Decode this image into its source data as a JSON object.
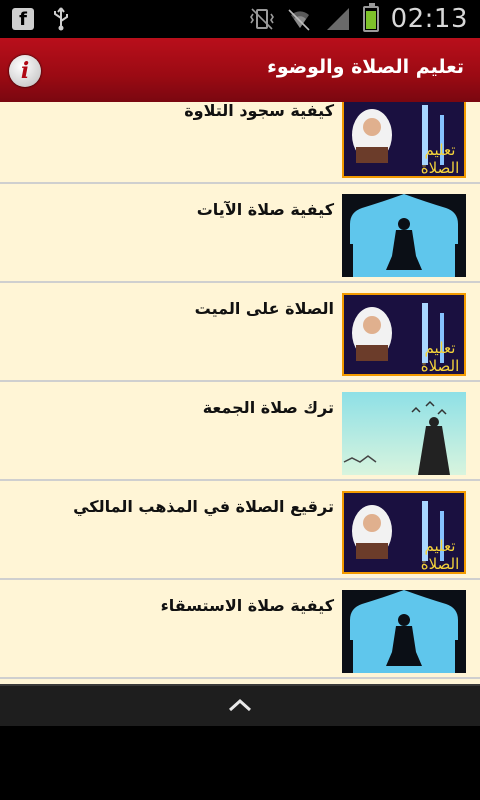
{
  "status_bar": {
    "time": "02:13"
  },
  "app_bar": {
    "title": "تعليم الصلاة والوضوء"
  },
  "list": {
    "items": [
      {
        "title": "كيفية سجود التلاوة",
        "thumb": "girl-reading-quran-image",
        "thumb_text": "تعليم الصلاة"
      },
      {
        "title": "كيفية صلاة الآيات",
        "thumb": "praying-man-silhouette-image"
      },
      {
        "title": "الصلاة على الميت",
        "thumb": "girl-reading-quran-image",
        "thumb_text": "تعليم الصلاة"
      },
      {
        "title": "ترك صلاة الجمعة",
        "thumb": "whirling-dervish-image"
      },
      {
        "title": "ترقيع الصلاة في المذهب المالكي",
        "thumb": "girl-reading-quran-image",
        "thumb_text": "تعليم الصلاة"
      },
      {
        "title": "كيفية صلاة الاستسقاء",
        "thumb": "praying-man-silhouette-image"
      }
    ]
  },
  "colors": {
    "app_bar": "#9a0a13",
    "list_background": "#fff5d6",
    "divider": "#cfcfcf"
  }
}
